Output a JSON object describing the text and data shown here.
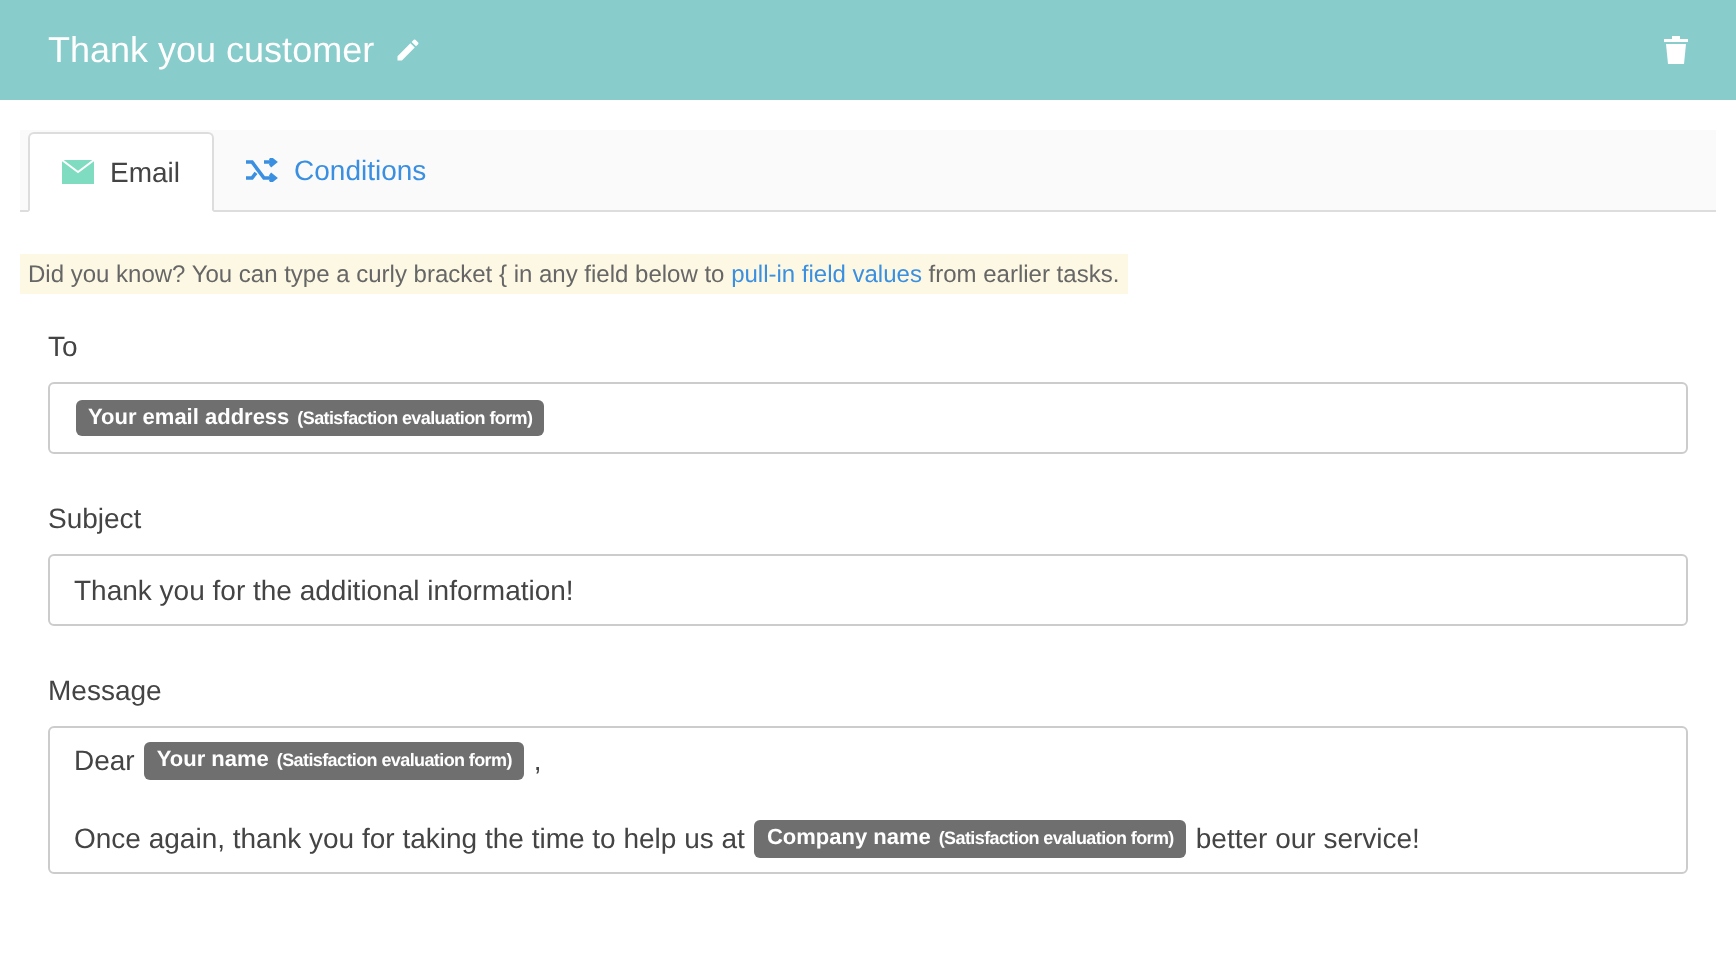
{
  "header": {
    "title": "Thank you customer"
  },
  "tabs": [
    {
      "label": "Email",
      "selected": true,
      "kind": "email"
    },
    {
      "label": "Conditions",
      "selected": false,
      "kind": "shuffle"
    }
  ],
  "hint": {
    "before": "Did you know? You can type a curly bracket { in any field below to",
    "link": "pull-in field values",
    "after": "from earlier tasks."
  },
  "fields": [
    {
      "label": "To",
      "lines": [
        [
          {
            "kind": "token",
            "name": "Your email address",
            "source": "(Satisfaction evaluation form)"
          }
        ]
      ]
    },
    {
      "label": "Subject",
      "lines": [
        [
          {
            "kind": "text",
            "text": "Thank you for the additional information!"
          }
        ]
      ]
    },
    {
      "label": "Message",
      "lines": [
        [
          {
            "kind": "text",
            "text": "Dear"
          },
          {
            "kind": "token",
            "name": "Your name",
            "source": "(Satisfaction evaluation form)"
          },
          {
            "kind": "text",
            "text": ","
          }
        ],
        [
          {
            "kind": "text",
            "text": "Once again, thank you for taking the time to help us at"
          },
          {
            "kind": "token",
            "name": "Company name",
            "source": "(Satisfaction evaluation form)"
          },
          {
            "kind": "text",
            "text": "better our service!"
          }
        ]
      ]
    }
  ]
}
